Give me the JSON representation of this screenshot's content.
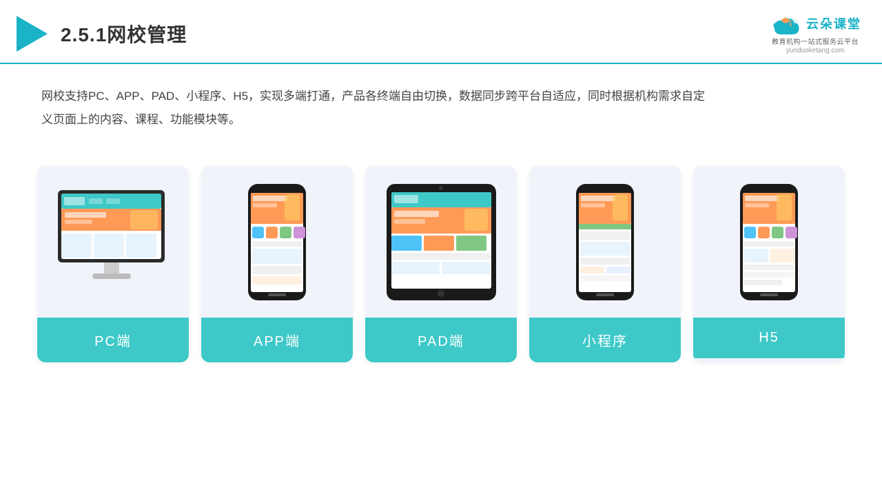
{
  "header": {
    "title": "2.5.1网校管理",
    "logo_main": "云朵课堂",
    "logo_url": "yunduoketang.com",
    "logo_tagline1": "教育机构一站",
    "logo_tagline2": "式服务云平台"
  },
  "description": {
    "text": "网校支持PC、APP、PAD、小程序、H5，实现多端打通，产品各终端自由切换，数据同步跨平台自适应，同时根据机构需求自定义页面上的内容、课程、功能模块等。"
  },
  "cards": [
    {
      "id": "pc",
      "label": "PC端",
      "device": "pc"
    },
    {
      "id": "app",
      "label": "APP端",
      "device": "phone"
    },
    {
      "id": "pad",
      "label": "PAD端",
      "device": "tablet"
    },
    {
      "id": "miniprogram",
      "label": "小程序",
      "device": "phone"
    },
    {
      "id": "h5",
      "label": "H5",
      "device": "phone"
    }
  ]
}
